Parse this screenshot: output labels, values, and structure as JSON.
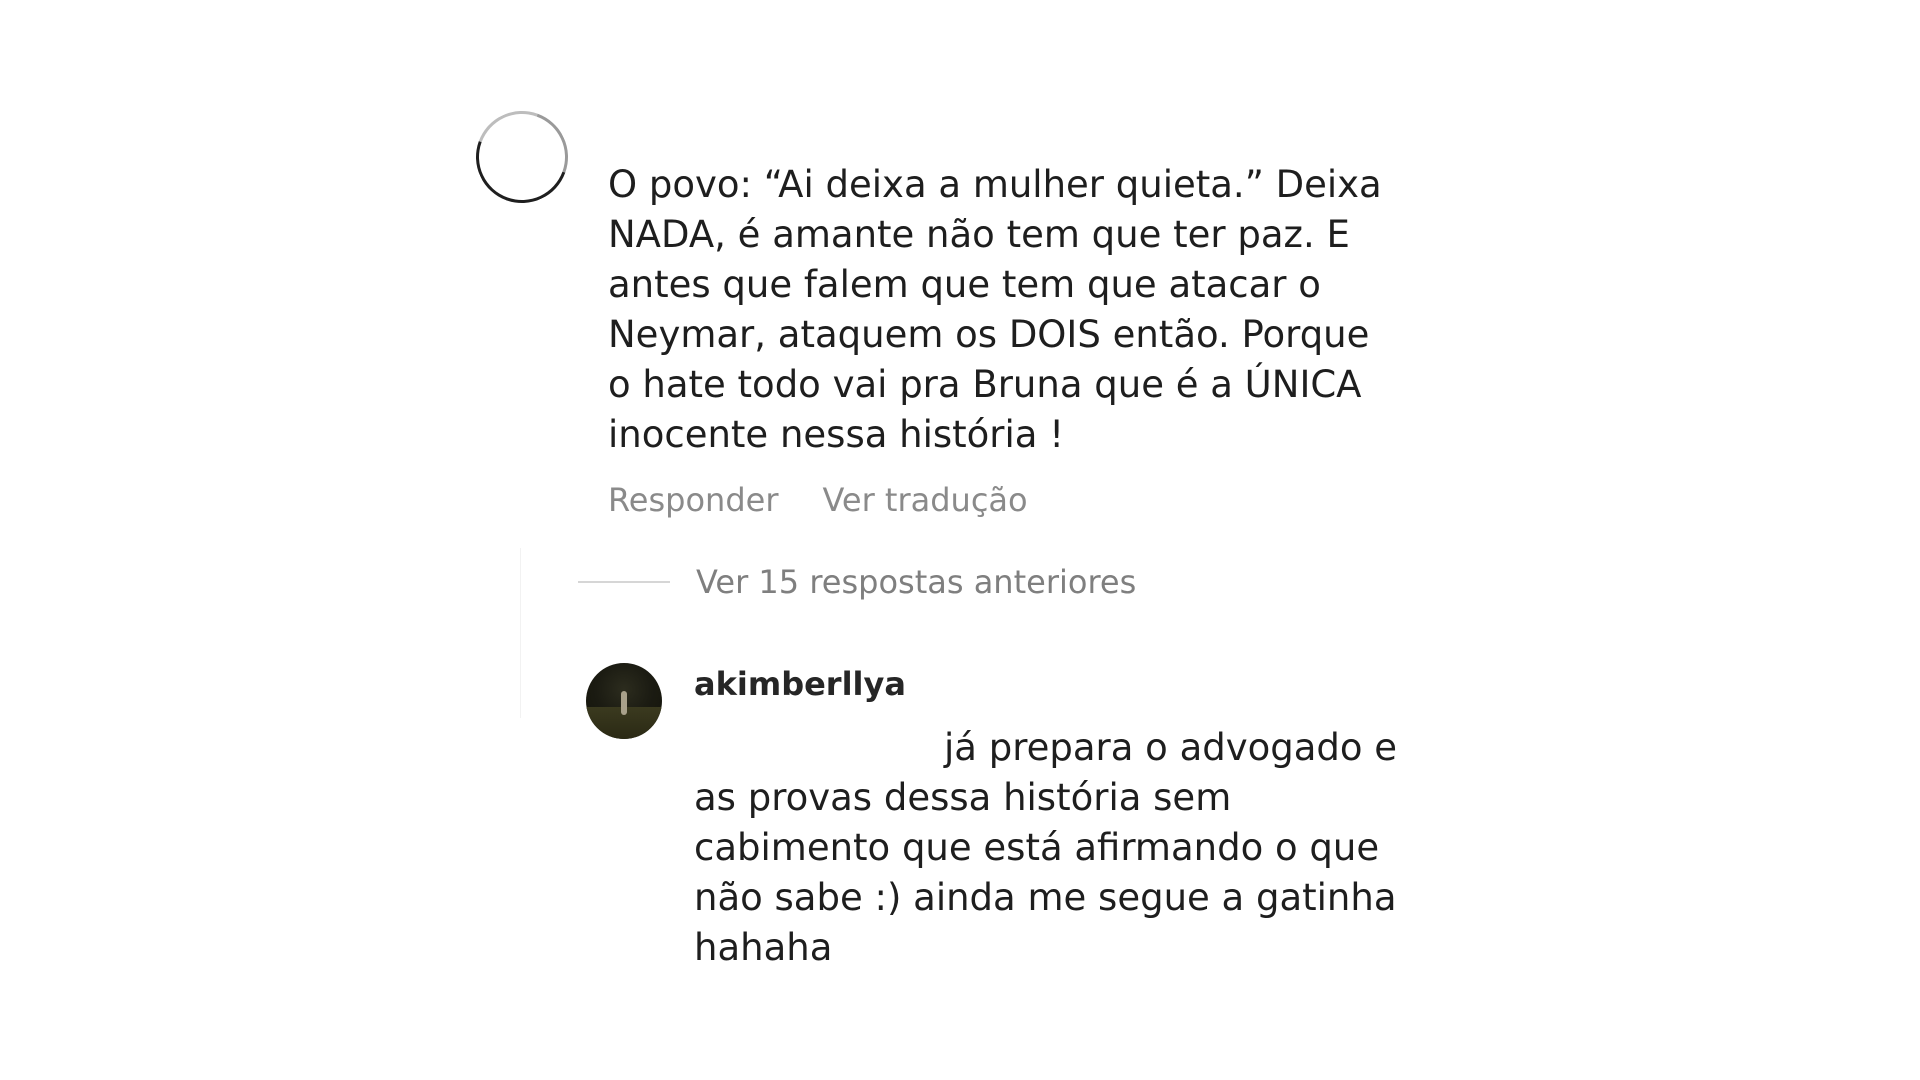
{
  "comment": {
    "text": "O povo: “Ai deixa a mulher quieta.” Deixa\nNADA, é amante não tem que ter paz. E\nantes que falem que tem que atacar o\nNeymar, ataquem os DOIS então. Porque\no hate todo vai pra Bruna que é a ÚNICA\ninocente nessa história !",
    "actions": {
      "reply_label": "Responder",
      "translate_label": "Ver tradução"
    }
  },
  "thread": {
    "view_replies_label": "Ver 15 respostas anteriores"
  },
  "reply": {
    "username": "akimberllya",
    "text": "já prepara o advogado e\nas provas dessa história sem\ncabimento que está afirmando o que\nnão sabe :) ainda me segue a gatinha\nhahaha"
  }
}
